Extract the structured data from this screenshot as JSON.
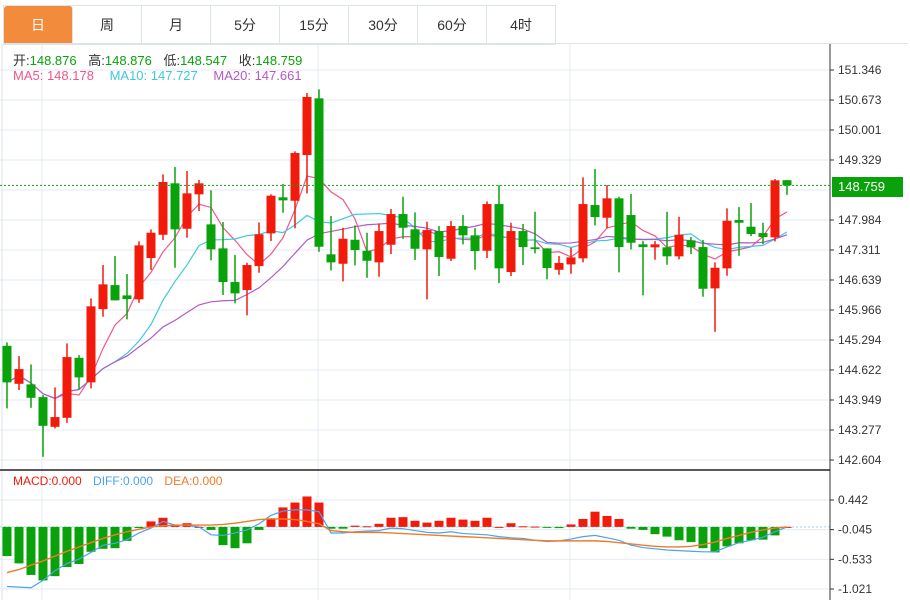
{
  "tabs": [
    "日",
    "周",
    "月",
    "5分",
    "15分",
    "30分",
    "60分",
    "4时"
  ],
  "active_tab": 0,
  "ohlc_info": {
    "open_label": "开:",
    "open": "148.876",
    "high_label": "高:",
    "high": "148.876",
    "low_label": "低:",
    "low": "148.547",
    "close_label": "收:",
    "close": "148.759"
  },
  "ma_info": {
    "ma5": "MA5: 148.178",
    "ma10": "MA10: 147.727",
    "ma20": "MA20: 147.661"
  },
  "macd_info": {
    "macd": "MACD:0.000",
    "diff": "DIFF:0.000",
    "dea": "DEA:0.000"
  },
  "current_price": "148.759",
  "colors": {
    "up": "#f21a0a",
    "down": "#0aa20a",
    "ma5": "#f0568a",
    "ma10": "#3ec8e0",
    "ma20": "#b25ac8",
    "diff": "#4aa3f0",
    "dea": "#f07a2a",
    "accent": "#f28c3c"
  },
  "chart_data": {
    "type": "candlestick",
    "price_axis": {
      "range": [
        142.604,
        151.346
      ],
      "ticks": [
        "151.346",
        "150.673",
        "150.001",
        "149.329",
        "147.984",
        "147.311",
        "146.639",
        "145.966",
        "145.294",
        "144.622",
        "143.949",
        "143.277",
        "142.604"
      ]
    },
    "candles": [
      [
        145.164,
        145.24,
        143.761,
        144.344
      ],
      [
        144.312,
        144.933,
        144.171,
        144.642
      ],
      [
        144.299,
        144.747,
        143.774,
        143.998
      ],
      [
        144.014,
        144.059,
        142.675,
        143.37
      ],
      [
        143.348,
        144.231,
        143.312,
        143.566
      ],
      [
        143.55,
        145.218,
        143.438,
        144.911
      ],
      [
        144.895,
        144.956,
        144.187,
        144.456
      ],
      [
        144.344,
        146.227,
        144.209,
        146.048
      ],
      [
        145.987,
        146.974,
        145.815,
        146.541
      ],
      [
        146.525,
        147.175,
        146.182,
        146.182
      ],
      [
        146.294,
        146.772,
        145.756,
        146.211
      ],
      [
        146.205,
        147.505,
        146.128,
        147.415
      ],
      [
        147.131,
        147.774,
        146.862,
        147.698
      ],
      [
        147.653,
        149.007,
        147.534,
        148.835
      ],
      [
        148.806,
        149.171,
        146.913,
        147.774
      ],
      [
        147.788,
        149.081,
        147.586,
        148.581
      ],
      [
        148.559,
        148.88,
        148.185,
        148.806
      ],
      [
        147.886,
        148.649,
        147.079,
        147.326
      ],
      [
        147.348,
        147.938,
        146.301,
        146.593
      ],
      [
        146.593,
        147.198,
        146.115,
        146.339
      ],
      [
        146.413,
        147.025,
        145.846,
        146.974
      ],
      [
        146.951,
        147.931,
        146.801,
        147.662
      ],
      [
        147.684,
        148.559,
        147.512,
        148.528
      ],
      [
        148.492,
        148.79,
        148.146,
        148.424
      ],
      [
        148.415,
        149.523,
        147.797,
        149.485
      ],
      [
        149.44,
        150.83,
        148.581,
        150.741
      ],
      [
        150.711,
        150.913,
        147.272,
        147.384
      ],
      [
        147.214,
        148.072,
        146.855,
        147.034
      ],
      [
        147.003,
        147.81,
        146.608,
        147.563
      ],
      [
        147.541,
        147.864,
        146.967,
        147.31
      ],
      [
        147.294,
        147.698,
        146.689,
        147.07
      ],
      [
        147.034,
        147.909,
        146.711,
        147.736
      ],
      [
        147.429,
        148.229,
        147.22,
        148.117
      ],
      [
        148.117,
        148.505,
        147.563,
        147.81
      ],
      [
        147.774,
        148.155,
        147.086,
        147.339
      ],
      [
        147.326,
        147.945,
        146.205,
        147.758
      ],
      [
        147.736,
        147.848,
        146.727,
        147.153
      ],
      [
        147.115,
        147.96,
        147.063,
        147.848
      ],
      [
        147.848,
        148.095,
        147.438,
        147.64
      ],
      [
        147.64,
        147.803,
        146.868,
        147.288
      ],
      [
        147.294,
        148.402,
        147.131,
        148.341
      ],
      [
        148.341,
        148.761,
        146.57,
        146.9
      ],
      [
        146.817,
        147.922,
        146.727,
        147.736
      ],
      [
        147.736,
        147.893,
        146.974,
        147.377
      ],
      [
        147.371,
        148.169,
        147.236,
        147.332
      ],
      [
        147.348,
        147.348,
        146.653,
        146.906
      ],
      [
        146.868,
        147.175,
        146.756,
        147.019
      ],
      [
        146.989,
        147.362,
        146.779,
        147.146
      ],
      [
        147.124,
        148.94,
        147.034,
        148.341
      ],
      [
        148.319,
        149.126,
        147.864,
        148.05
      ],
      [
        148.034,
        148.767,
        147.797,
        148.469
      ],
      [
        148.469,
        148.505,
        146.81,
        147.377
      ],
      [
        148.095,
        148.566,
        147.326,
        147.474
      ],
      [
        147.438,
        147.512,
        146.294,
        147.377
      ],
      [
        147.371,
        147.512,
        147.093,
        147.438
      ],
      [
        147.371,
        148.169,
        146.98,
        147.169
      ],
      [
        147.169,
        148.057,
        147.101,
        147.653
      ],
      [
        147.528,
        147.602,
        147.22,
        147.371
      ],
      [
        147.377,
        147.534,
        146.263,
        146.442
      ],
      [
        146.451,
        147.034,
        145.478,
        146.913
      ],
      [
        146.9,
        148.245,
        146.734,
        147.967
      ],
      [
        147.983,
        148.274,
        147.182,
        147.922
      ],
      [
        147.833,
        148.364,
        147.624,
        147.669
      ],
      [
        147.691,
        147.922,
        147.444,
        147.602
      ],
      [
        147.595,
        148.902,
        147.505,
        148.873
      ],
      [
        148.876,
        148.876,
        148.547,
        148.759
      ]
    ],
    "candle_format": [
      "open",
      "high",
      "low",
      "close"
    ],
    "moving_averages": [
      5,
      10,
      20
    ],
    "macd": {
      "axis": {
        "range": [
          -1.021,
          0.442
        ],
        "ticks": [
          "0.442",
          "-0.045",
          "-0.533",
          "-1.021"
        ]
      },
      "histogram": [
        -0.48,
        -0.6,
        -0.79,
        -0.88,
        -0.81,
        -0.66,
        -0.61,
        -0.41,
        -0.36,
        -0.35,
        -0.23,
        -0.02,
        0.09,
        0.15,
        0.02,
        0.06,
        0.0,
        -0.05,
        -0.3,
        -0.35,
        -0.27,
        -0.05,
        0.14,
        0.32,
        0.4,
        0.5,
        0.4,
        -0.03,
        -0.03,
        0.02,
        0.01,
        0.05,
        0.15,
        0.16,
        0.1,
        0.07,
        0.1,
        0.15,
        0.12,
        0.1,
        0.15,
        0.0,
        0.06,
        0.01,
        0.005,
        -0.01,
        -0.02,
        0.04,
        0.13,
        0.25,
        0.18,
        0.13,
        -0.03,
        -0.05,
        -0.12,
        -0.16,
        -0.22,
        -0.25,
        -0.35,
        -0.42,
        -0.32,
        -0.27,
        -0.22,
        -0.21,
        -0.14,
        0.0
      ],
      "diff": [
        -0.98,
        -0.99,
        -1.0,
        -0.88,
        -0.72,
        -0.6,
        -0.53,
        -0.42,
        -0.3,
        -0.27,
        -0.21,
        -0.1,
        -0.02,
        0.09,
        0.03,
        0.03,
        0.0,
        -0.13,
        -0.14,
        -0.1,
        -0.05,
        0.05,
        0.19,
        0.26,
        0.28,
        0.28,
        0.25,
        -0.1,
        -0.1,
        -0.08,
        -0.07,
        -0.06,
        -0.02,
        -0.03,
        -0.06,
        -0.09,
        -0.1,
        -0.08,
        -0.11,
        -0.12,
        -0.13,
        -0.16,
        -0.18,
        -0.19,
        -0.22,
        -0.24,
        -0.23,
        -0.2,
        -0.16,
        -0.14,
        -0.18,
        -0.22,
        -0.3,
        -0.34,
        -0.36,
        -0.38,
        -0.39,
        -0.4,
        -0.41,
        -0.41,
        -0.33,
        -0.26,
        -0.22,
        -0.17,
        -0.08,
        0.0
      ],
      "dea": [
        -0.75,
        -0.7,
        -0.63,
        -0.56,
        -0.48,
        -0.4,
        -0.33,
        -0.26,
        -0.19,
        -0.13,
        -0.08,
        -0.04,
        0.0,
        0.02,
        0.03,
        0.03,
        0.03,
        0.03,
        0.04,
        0.06,
        0.09,
        0.12,
        0.13,
        0.13,
        0.12,
        0.09,
        0.05,
        -0.06,
        -0.08,
        -0.09,
        -0.09,
        -0.09,
        -0.1,
        -0.11,
        -0.12,
        -0.13,
        -0.14,
        -0.15,
        -0.16,
        -0.17,
        -0.18,
        -0.19,
        -0.2,
        -0.21,
        -0.22,
        -0.23,
        -0.23,
        -0.23,
        -0.23,
        -0.23,
        -0.24,
        -0.26,
        -0.28,
        -0.3,
        -0.32,
        -0.33,
        -0.33,
        -0.32,
        -0.29,
        -0.25,
        -0.19,
        -0.14,
        -0.09,
        -0.05,
        -0.02,
        0.0
      ]
    }
  }
}
